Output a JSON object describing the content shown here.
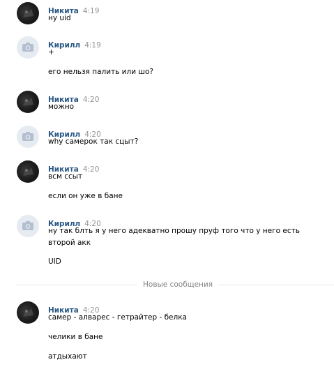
{
  "messages": [
    {
      "author": "Никита",
      "time": "4:19",
      "avatar": "user-photo",
      "lines": [
        "ну uid"
      ]
    },
    {
      "author": "Кирилл",
      "time": "4:19",
      "avatar": "camera-icon",
      "lines": [
        "+",
        "его нельзя палить или шо?"
      ]
    },
    {
      "author": "Никита",
      "time": "4:20",
      "avatar": "user-photo",
      "lines": [
        "можно"
      ]
    },
    {
      "author": "Кирилл",
      "time": "4:20",
      "avatar": "camera-icon",
      "lines": [
        "why самерок так сцыт?"
      ]
    },
    {
      "author": "Никита",
      "time": "4:20",
      "avatar": "user-photo",
      "lines": [
        "всм ссыт",
        "если он уже в бане"
      ]
    },
    {
      "author": "Кирилл",
      "time": "4:20",
      "avatar": "camera-icon",
      "lines": [
        "ну так блть я у него адекватно прошу пруф того что у него есть",
        "второй акк",
        "UID"
      ]
    },
    {
      "author": "Никита",
      "time": "4:20",
      "avatar": "user-photo",
      "lines": [
        "самер - алварес - гетрайтер - белка",
        "челики в бане",
        "атдыхают"
      ]
    }
  ],
  "divider": {
    "label": "Новые сообщения"
  },
  "colors": {
    "author": "#2a5885",
    "time": "#939393",
    "divider": "#e7e8ec",
    "camera_bg": "#e6ebf1"
  }
}
